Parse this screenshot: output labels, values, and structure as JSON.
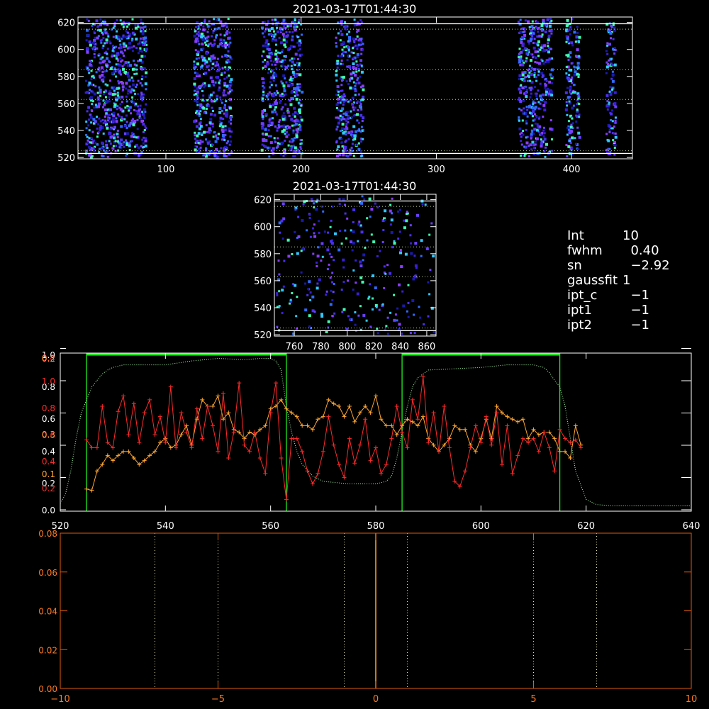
{
  "colors": {
    "background": "#000000",
    "axis": "#ffffff",
    "red_series": "#ff2a2a",
    "orange_series": "#ffa630",
    "green_fit": "#a8ffa8",
    "green_box": "#22ee22",
    "bottom_axis": "#e05a10",
    "bottom_tick_text": "#ff7a20",
    "bottom_line": "#ffa630"
  },
  "params": [
    {
      "key": "Int",
      "value": "10"
    },
    {
      "key": "fwhm",
      "value": "  0.40"
    },
    {
      "key": "sn",
      "value": "  −2.92"
    },
    {
      "key": "gaussfit",
      "value": "1"
    },
    {
      "key": "ipt_c",
      "value": "  −1"
    },
    {
      "key": "ipt1",
      "value": "  −1"
    },
    {
      "key": "ipt2",
      "value": "  −1"
    }
  ],
  "chart_data": [
    {
      "type": "heatmap",
      "title": "2021-03-17T01:44:30",
      "xlim": [
        35,
        445
      ],
      "ylim": [
        519,
        624
      ],
      "x_ticks": [
        100,
        200,
        300,
        400
      ],
      "y_ticks": [
        520,
        540,
        560,
        580,
        600,
        620
      ],
      "hlines_dotted": [
        615,
        585,
        563,
        525
      ],
      "hlines_solid": [
        619,
        523
      ],
      "point_bands": [
        [
          40,
          62
        ],
        [
          62,
          85
        ],
        [
          120,
          148
        ],
        [
          170,
          200
        ],
        [
          225,
          245
        ],
        [
          360,
          385
        ],
        [
          395,
          405
        ],
        [
          425,
          432
        ]
      ]
    },
    {
      "type": "heatmap",
      "title": "2021-03-17T01:44:30",
      "xlim": [
        745,
        867
      ],
      "ylim": [
        519,
        624
      ],
      "x_ticks": [
        760,
        780,
        800,
        820,
        840,
        860
      ],
      "y_ticks": [
        520,
        540,
        560,
        580,
        600,
        620
      ],
      "hlines_dotted": [
        615,
        585,
        563,
        525
      ],
      "hlines_solid": [
        619,
        523
      ]
    },
    {
      "type": "line",
      "xlim": [
        520,
        640
      ],
      "x_ticks": [
        520,
        540,
        560,
        580,
        600,
        620,
        640
      ],
      "left_ticks_white": [
        "0.0",
        "0.2",
        "0.4",
        "0.6",
        "0.8",
        "1.0"
      ],
      "left_ticks_red": [
        "0.2",
        "0.4",
        "0.6",
        "0.8",
        "1.0",
        "0.4"
      ],
      "left_ticks_orange": [
        "0.1",
        "0.3",
        "0.2"
      ],
      "fit_regions": [
        [
          525,
          563
        ],
        [
          585,
          615
        ]
      ],
      "series": [
        {
          "name": "red",
          "x": [
            525,
            526,
            527,
            528,
            529,
            530,
            531,
            532,
            533,
            534,
            535,
            536,
            537,
            538,
            539,
            540,
            541,
            542,
            543,
            544,
            545,
            546,
            547,
            548,
            549,
            550,
            551,
            552,
            553,
            554,
            555,
            556,
            557,
            558,
            559,
            560,
            561,
            562,
            563,
            564,
            565,
            566,
            567,
            568,
            569,
            570,
            571,
            572,
            573,
            574,
            575,
            576,
            577,
            578,
            579,
            580,
            581,
            582,
            583,
            584,
            585,
            586,
            587,
            588,
            589,
            590,
            591,
            592,
            593,
            594,
            595,
            596,
            597,
            598,
            599,
            600,
            601,
            602,
            603,
            604,
            605,
            606,
            607,
            608,
            609,
            610,
            611,
            612,
            613,
            614,
            615,
            616,
            617,
            618,
            619
          ],
          "y": [
            0.54,
            0.48,
            0.48,
            0.8,
            0.52,
            0.48,
            0.76,
            0.88,
            0.58,
            0.82,
            0.52,
            0.75,
            0.85,
            0.58,
            0.72,
            0.52,
            0.95,
            0.48,
            0.75,
            0.6,
            0.48,
            0.78,
            0.55,
            0.8,
            0.65,
            0.45,
            0.9,
            0.4,
            0.6,
            0.98,
            0.5,
            0.45,
            0.6,
            0.4,
            0.28,
            0.75,
            0.98,
            0.4,
            0.08,
            0.55,
            0.55,
            0.45,
            0.3,
            0.2,
            0.28,
            0.45,
            0.72,
            0.5,
            0.35,
            0.25,
            0.55,
            0.36,
            0.5,
            0.7,
            0.38,
            0.48,
            0.28,
            0.35,
            0.55,
            0.8,
            0.6,
            0.48,
            0.85,
            0.7,
            1.03,
            0.52,
            0.75,
            0.45,
            0.8,
            0.48,
            0.22,
            0.18,
            0.3,
            0.48,
            0.65,
            0.52,
            0.72,
            0.5,
            0.75,
            0.35,
            0.65,
            0.28,
            0.42,
            0.55,
            0.52,
            0.55,
            0.45,
            0.6,
            0.48,
            0.3,
            0.62,
            0.55,
            0.52,
            0.54,
            0.48
          ]
        },
        {
          "name": "orange",
          "x": [
            525,
            526,
            527,
            528,
            529,
            530,
            531,
            532,
            533,
            534,
            535,
            536,
            537,
            538,
            539,
            540,
            541,
            542,
            543,
            544,
            545,
            546,
            547,
            548,
            549,
            550,
            551,
            552,
            553,
            554,
            555,
            556,
            557,
            558,
            559,
            560,
            561,
            562,
            563,
            564,
            565,
            566,
            567,
            568,
            569,
            570,
            571,
            572,
            573,
            574,
            575,
            576,
            577,
            578,
            579,
            580,
            581,
            582,
            583,
            584,
            585,
            586,
            587,
            588,
            589,
            590,
            591,
            592,
            593,
            594,
            595,
            596,
            597,
            598,
            599,
            600,
            601,
            602,
            603,
            604,
            605,
            606,
            607,
            608,
            609,
            610,
            611,
            612,
            613,
            614,
            615,
            616,
            617,
            618,
            619
          ],
          "y": [
            0.16,
            0.15,
            0.3,
            0.35,
            0.42,
            0.38,
            0.42,
            0.45,
            0.45,
            0.4,
            0.35,
            0.38,
            0.42,
            0.45,
            0.52,
            0.55,
            0.48,
            0.5,
            0.58,
            0.65,
            0.5,
            0.7,
            0.85,
            0.8,
            0.8,
            0.88,
            0.7,
            0.75,
            0.62,
            0.6,
            0.55,
            0.6,
            0.58,
            0.62,
            0.65,
            0.78,
            0.8,
            0.85,
            0.78,
            0.75,
            0.72,
            0.65,
            0.65,
            0.62,
            0.7,
            0.72,
            0.85,
            0.82,
            0.8,
            0.72,
            0.8,
            0.68,
            0.75,
            0.8,
            0.75,
            0.88,
            0.7,
            0.65,
            0.65,
            0.58,
            0.65,
            0.7,
            0.68,
            0.65,
            0.72,
            0.55,
            0.5,
            0.45,
            0.5,
            0.55,
            0.65,
            0.62,
            0.62,
            0.5,
            0.45,
            0.55,
            0.7,
            0.55,
            0.8,
            0.75,
            0.72,
            0.7,
            0.68,
            0.7,
            0.55,
            0.62,
            0.58,
            0.6,
            0.6,
            0.55,
            0.45,
            0.45,
            0.4,
            0.65,
            0.5
          ]
        },
        {
          "name": "fit",
          "x": [
            520,
            521,
            522,
            523,
            524,
            525,
            526,
            527,
            528,
            529,
            530,
            531,
            532,
            533,
            535,
            540,
            545,
            550,
            555,
            558,
            560,
            561,
            562,
            563,
            564,
            565,
            566,
            568,
            570,
            575,
            580,
            582,
            583,
            584,
            585,
            586,
            587,
            588,
            590,
            595,
            600,
            605,
            610,
            612,
            613,
            614,
            615,
            616,
            617,
            618,
            620,
            622,
            625,
            630,
            635,
            640
          ],
          "y": [
            0.05,
            0.12,
            0.3,
            0.55,
            0.75,
            0.85,
            0.95,
            1.0,
            1.05,
            1.08,
            1.1,
            1.11,
            1.12,
            1.12,
            1.12,
            1.12,
            1.15,
            1.17,
            1.16,
            1.17,
            1.17,
            1.15,
            1.08,
            0.8,
            0.6,
            0.45,
            0.35,
            0.26,
            0.22,
            0.2,
            0.2,
            0.22,
            0.26,
            0.4,
            0.6,
            0.8,
            0.95,
            1.02,
            1.08,
            1.09,
            1.1,
            1.12,
            1.12,
            1.1,
            1.06,
            1.0,
            0.95,
            0.8,
            0.55,
            0.3,
            0.08,
            0.04,
            0.03,
            0.03,
            0.03,
            0.03
          ]
        }
      ]
    },
    {
      "type": "line",
      "xlim": [
        -10,
        10
      ],
      "ylim": [
        0,
        0.08
      ],
      "x_ticks": [
        "−10",
        "−5",
        "0",
        "5",
        "10"
      ],
      "x_tick_values": [
        -10,
        -5,
        0,
        5,
        10
      ],
      "y_ticks": [
        "0.00",
        "0.02",
        "0.04",
        "0.06",
        "0.08"
      ],
      "y_tick_values": [
        0,
        0.02,
        0.04,
        0.06,
        0.08
      ],
      "vlines_dotted": [
        -7,
        -5,
        -1,
        1,
        5,
        7
      ],
      "vline_solid": 0
    }
  ]
}
